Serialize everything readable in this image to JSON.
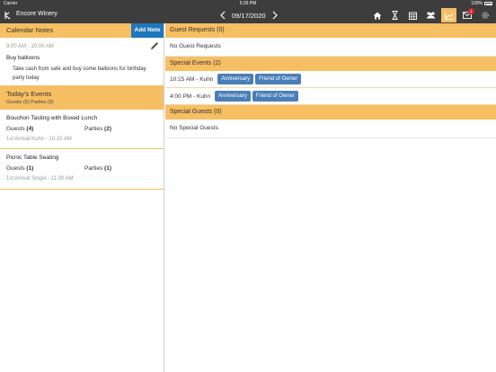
{
  "status_bar": {
    "carrier": "Carrier",
    "time": "5:26 PM",
    "battery": "100%"
  },
  "nav": {
    "app_title": "Encore Winery",
    "date": "09/17/2020",
    "icons": [
      "home-icon",
      "hourglass-icon",
      "calendar-icon",
      "guests-icon",
      "chart-icon",
      "mail-icon",
      "settings-icon"
    ],
    "mail_badge": "1",
    "active_icon": "chart-icon"
  },
  "colors": {
    "accent": "#f6bf63",
    "nav_bg": "#3d3d3d",
    "button_blue": "#1f77bb",
    "tag_blue": "#4a7eb8",
    "badge_red": "#d9232d"
  },
  "calendar_notes": {
    "title": "Calendar Notes",
    "add_label": "Add Note",
    "note": {
      "time": "9:00 AM - 10:00 AM",
      "title": "Buy balloons",
      "body": "Take cash from safe and buy some balloons for birthday party today"
    }
  },
  "todays_events": {
    "title": "Today's Events",
    "summary": "Guests (5) Parties (3)",
    "events": [
      {
        "title": "Bouchon Tasting with Boxed Lunch",
        "guests_label": "Guests",
        "guests": "(4)",
        "parties_label": "Parties",
        "parties": "(2)",
        "arrival": "1st Arrival Kuhn - 10:15 AM"
      },
      {
        "title": "Picnic Table Seating",
        "guests_label": "Guests",
        "guests": "(1)",
        "parties_label": "Parties",
        "parties": "(1)",
        "arrival": "1st Arrival Singvi - 11:00 AM"
      }
    ]
  },
  "guest_requests": {
    "title": "Guest Requests",
    "count": "(0)",
    "empty": "No Guest Requests"
  },
  "special_events": {
    "title": "Special Events",
    "count": "(2)",
    "rows": [
      {
        "time": "10:15 AM - Kuhn",
        "tags": [
          "Anniversary",
          "Friend of Owner"
        ]
      },
      {
        "time": "4:00 PM - Kuhn",
        "tags": [
          "Anniversary",
          "Friend of Owner"
        ]
      }
    ]
  },
  "special_guests": {
    "title": "Special Guests",
    "count": "(0)",
    "empty": "No Special Guests"
  }
}
